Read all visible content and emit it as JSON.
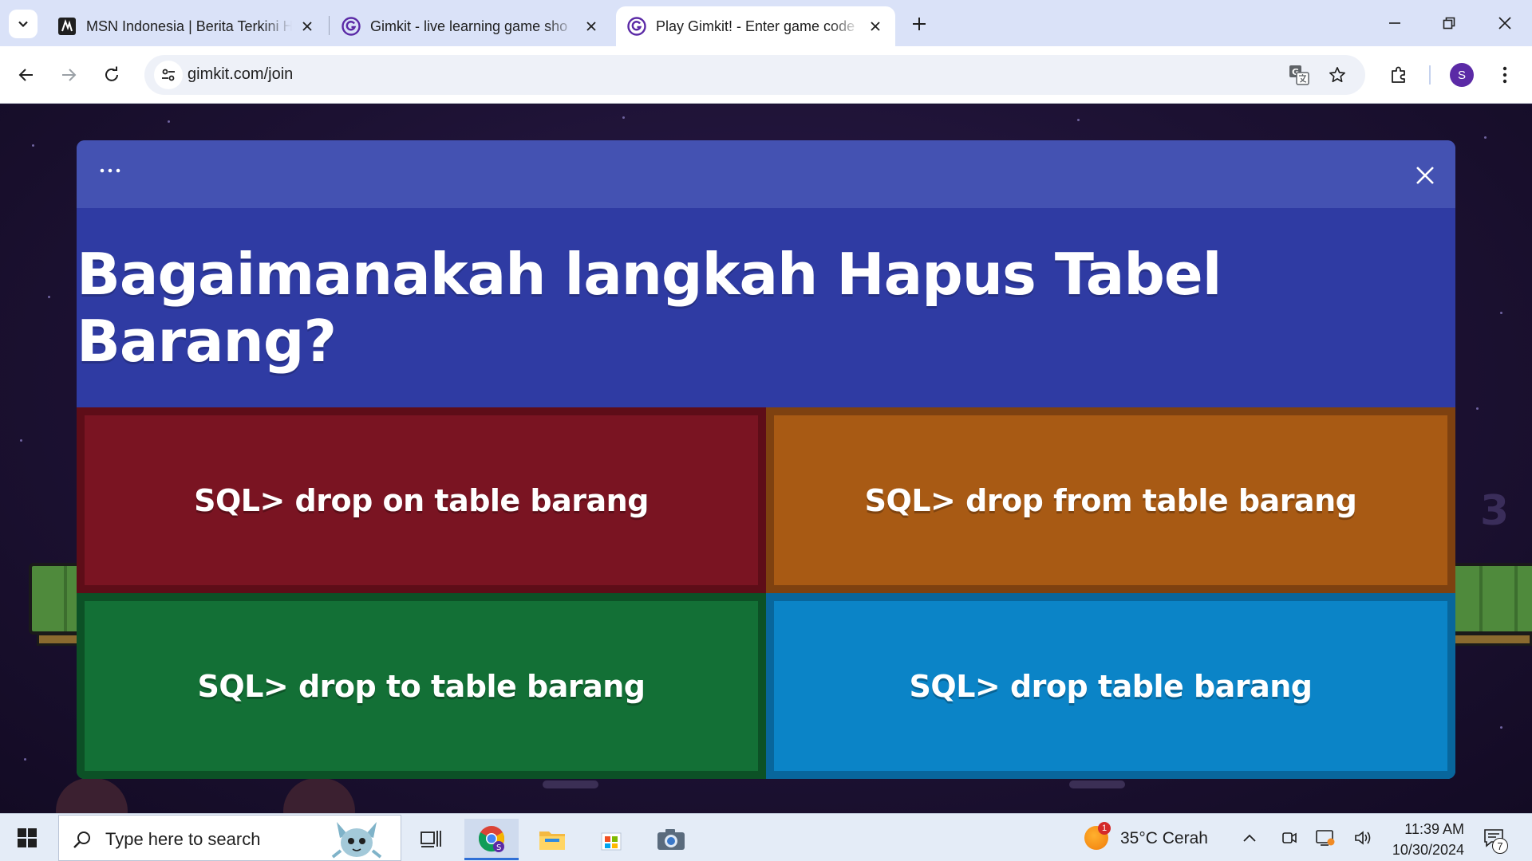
{
  "browser": {
    "tabs": [
      {
        "title": "MSN Indonesia | Berita Terkini H",
        "favicon": "msn-icon",
        "active": false
      },
      {
        "title": "Gimkit - live learning game sho",
        "favicon": "gimkit-icon",
        "active": false
      },
      {
        "title": "Play Gimkit! - Enter game code",
        "favicon": "gimkit-icon",
        "active": true
      }
    ],
    "url": "gimkit.com/join",
    "profile_initial": "S"
  },
  "modal": {
    "question": "Bagaimanakah langkah Hapus Tabel Barang?",
    "answers": [
      {
        "label": "SQL> drop on table barang",
        "color": "#7a1422"
      },
      {
        "label": "SQL> drop from table barang",
        "color": "#a85a14"
      },
      {
        "label": "SQL> drop to table barang",
        "color": "#137036"
      },
      {
        "label": "SQL> drop table barang",
        "color": "#0b84c7"
      }
    ]
  },
  "taskbar": {
    "search_placeholder": "Type here to search",
    "weather_badge": "1",
    "weather": "35°C  Cerah",
    "time": "11:39 AM",
    "date": "10/30/2024",
    "notifications": "7"
  }
}
